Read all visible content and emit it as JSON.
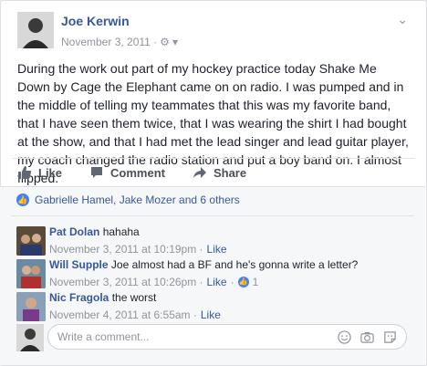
{
  "post": {
    "author": "Joe Kerwin",
    "date": "November 3, 2011 ·",
    "text": "During the work out part of my hockey practice today Shake Me Down by Cage the Elephant came on on radio. I was pumped and in the middle of telling my teammates that this was my favorite band, that I have seen them twice, that I was wearing the shirt I had bought at the show, and that I had met the lead singer and lead guitar player, my coach changed the radio station and put a boy band on. I almost flipped."
  },
  "actions": {
    "like": "Like",
    "comment": "Comment",
    "share": "Share"
  },
  "likes": {
    "text": "Gabrielle Hamel, Jake Mozer and 6 others"
  },
  "comments": [
    {
      "author": "Pat Dolan",
      "text": "hahaha",
      "timestamp": "November 3, 2011 at 10:19pm ·",
      "like_label": "Like"
    },
    {
      "author": "Will Supple",
      "text": "Joe almost had a BF and he's gonna write a letter?",
      "timestamp": "November 3, 2011 at 10:26pm ·",
      "like_label": "Like",
      "sep": "·",
      "reaction_count": "1"
    },
    {
      "author": "Nic Fragola",
      "text": "the worst",
      "timestamp": "November 4, 2011 at 6:55am ·",
      "like_label": "Like"
    }
  ],
  "composer": {
    "placeholder": "Write a comment..."
  },
  "colors": {
    "link": "#365899",
    "like_blue": "#4080ff",
    "background": "#e9ebee"
  }
}
